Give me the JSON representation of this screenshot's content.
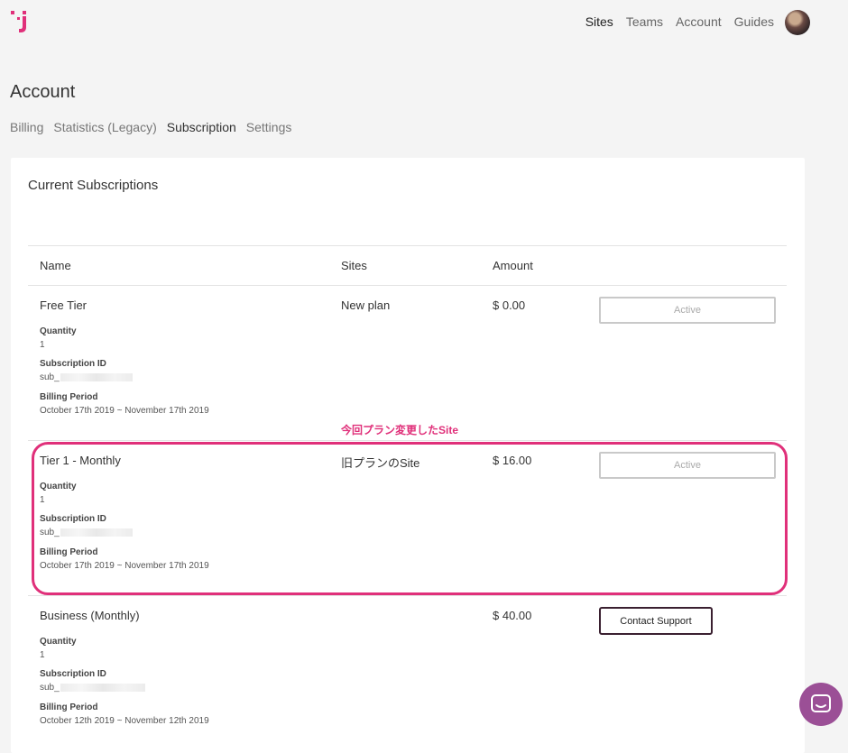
{
  "nav": {
    "items": [
      "Sites",
      "Teams",
      "Account",
      "Guides"
    ],
    "active": "Sites"
  },
  "page": {
    "title": "Account"
  },
  "tabs": {
    "items": [
      "Billing",
      "Statistics (Legacy)",
      "Subscription",
      "Settings"
    ],
    "active": "Subscription"
  },
  "card": {
    "title": "Current Subscriptions",
    "headers": {
      "name": "Name",
      "sites": "Sites",
      "amount": "Amount"
    }
  },
  "subscriptions": [
    {
      "name": "Free Tier",
      "sites": "New plan",
      "amount": "$ 0.00",
      "quantity_label": "Quantity",
      "quantity": "1",
      "sub_id_label": "Subscription ID",
      "sub_id": "sub_",
      "period_label": "Billing Period",
      "period": "October 17th 2019 ~ November 17th 2019",
      "action": "Active"
    },
    {
      "name": "Tier 1 - Monthly",
      "sites": "旧プランのSite",
      "amount": "$ 16.00",
      "quantity_label": "Quantity",
      "quantity": "1",
      "sub_id_label": "Subscription ID",
      "sub_id": "sub_",
      "period_label": "Billing Period",
      "period": "October 17th 2019 ~ November 17th 2019",
      "action": "Active"
    },
    {
      "name": "Business (Monthly)",
      "sites": "",
      "amount": "$ 40.00",
      "quantity_label": "Quantity",
      "quantity": "1",
      "sub_id_label": "Subscription ID",
      "sub_id": "sub_",
      "period_label": "Billing Period",
      "period": "October 12th 2019 ~ November 12th 2019",
      "action": "Contact Support"
    }
  ],
  "annotation": {
    "text": "今回プラン変更したSite"
  },
  "colors": {
    "brand": "#e0307a",
    "highlight": "#e0307a",
    "chat": "#9b4f96",
    "support_border": "#3a2030"
  },
  "icons": {
    "logo": "brand-logo-icon",
    "chat": "chat-bubble-icon"
  }
}
